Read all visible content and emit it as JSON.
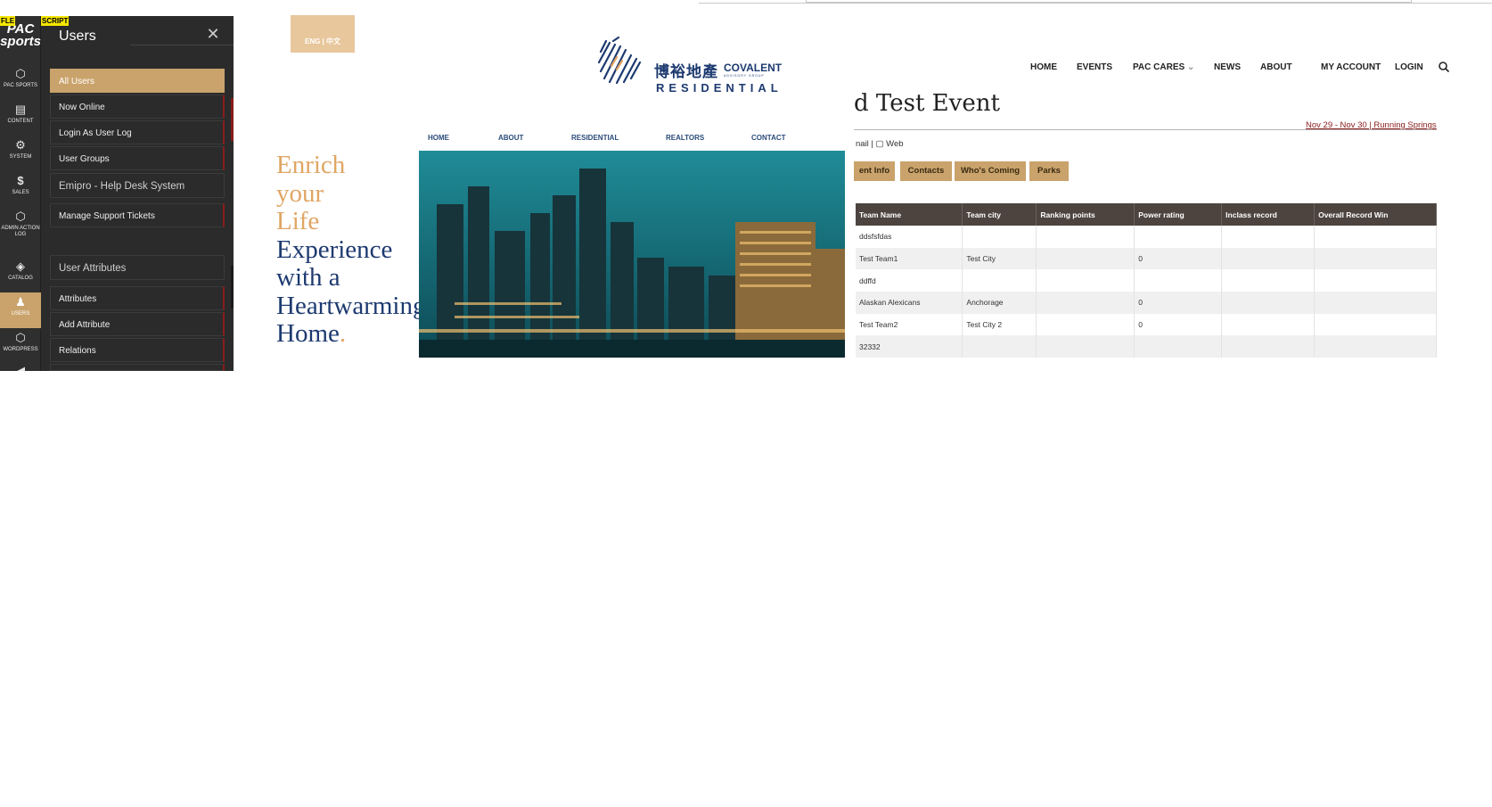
{
  "admin": {
    "tags": {
      "left": "FLE",
      "right": "SCRIPT"
    },
    "logo": {
      "line1": "PAC",
      "line2": "sports"
    },
    "rail": [
      {
        "label": "PAC SPORTS",
        "icon": "hexagon-icon"
      },
      {
        "label": "CONTENT",
        "icon": "content-icon"
      },
      {
        "label": "SYSTEM",
        "icon": "gear-icon"
      },
      {
        "label": "SALES",
        "icon": "dollar-icon"
      },
      {
        "label": "ADMIN ACTION LOG",
        "icon": "hexagon-icon"
      },
      {
        "label": "CATALOG",
        "icon": "box-icon"
      },
      {
        "label": "USERS",
        "icon": "user-icon",
        "active": true
      },
      {
        "label": "WORDPRESS",
        "icon": "hexagon-icon"
      }
    ],
    "menu": {
      "title": "Users",
      "items": [
        "All Users",
        "Now Online",
        "Login As User Log",
        "User Groups"
      ],
      "section1": "Emipro - Help Desk System",
      "section1_items": [
        "Manage Support Tickets"
      ],
      "section2": "User Attributes",
      "section2_items": [
        "Attributes",
        "Add Attribute",
        "Relations"
      ]
    }
  },
  "residential": {
    "lang": "ENG | 中文",
    "brand": {
      "cn": "博裕地產",
      "name": "COVALENT",
      "sub": "ADVISORY GROUP",
      "res": "RESIDENTIAL"
    },
    "nav": [
      "HOME",
      "ABOUT",
      "RESIDENTIAL",
      "REALTORS",
      "CONTACT"
    ],
    "hero": {
      "l1": "Enrich",
      "l2": "your",
      "l3": "Life",
      "l4": "Experience",
      "l5": "with a",
      "l6": "Heartwarming",
      "l7": "Home",
      "dot": "."
    }
  },
  "events": {
    "nav": [
      "HOME",
      "EVENTS",
      "PAC CARES",
      "NEWS",
      "ABOUT",
      "MY ACCOUNT",
      "LOGIN"
    ],
    "nav_caret": "⌄",
    "title": "d Test Event",
    "date": "Nov 29 - Nov 30 | Running Springs",
    "contact": "nail | ▢ Web",
    "tabs": [
      "ent Info",
      "Contacts",
      "Who's Coming",
      "Parks"
    ],
    "table": {
      "headers": [
        "Team Name",
        "Team city",
        "Ranking points",
        "Power rating",
        "Inclass record",
        "Overall Record Win"
      ],
      "rows": [
        [
          "ddsfsfdas",
          "",
          "",
          "",
          "",
          ""
        ],
        [
          "Test Team1",
          "Test City",
          "",
          "0",
          "",
          ""
        ],
        [
          "ddffd",
          "",
          "",
          "",
          "",
          ""
        ],
        [
          "Alaskan Alexicans",
          "Anchorage",
          "",
          "0",
          "",
          ""
        ],
        [
          "Test Team2",
          "Test City 2",
          "",
          "0",
          "",
          ""
        ],
        [
          "32332",
          "",
          "",
          "",
          "",
          ""
        ]
      ]
    }
  },
  "colors": {
    "gold": "#c9a36b",
    "navy": "#1d3a70",
    "dark": "#2b2b2b",
    "red": "#8a1c1c"
  }
}
